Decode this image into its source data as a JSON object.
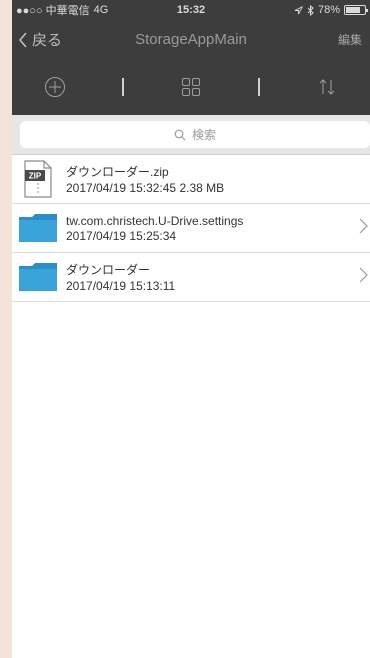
{
  "status": {
    "carrier": "●●○○ 中華電信",
    "network": "4G",
    "time": "15:32",
    "battery_text": "78%",
    "battery_level": 0.78
  },
  "nav": {
    "back_label": "戻る",
    "title": "StorageAppMain",
    "edit_label": "編集"
  },
  "toolbar": {
    "items": [
      "add-icon",
      "grid-icon",
      "sort-icon"
    ]
  },
  "search": {
    "placeholder": "検索"
  },
  "files": [
    {
      "name": "ダウンローダー.zip",
      "meta": "2017/04/19 15:32:45  2.38 MB",
      "kind": "zip-icon",
      "zip_label": "ZIP"
    },
    {
      "name": "tw.com.christech.U-Drive.settings",
      "meta": "2017/04/19 15:25:34",
      "kind": "folder-icon"
    },
    {
      "name": "ダウンローダー",
      "meta": "2017/04/19 15:13:11",
      "kind": "folder-icon"
    }
  ],
  "colors": {
    "bar_dark": "#3d3d3d",
    "folder_blue": "#2a8fc7",
    "background_outside": "#f2e4db"
  }
}
